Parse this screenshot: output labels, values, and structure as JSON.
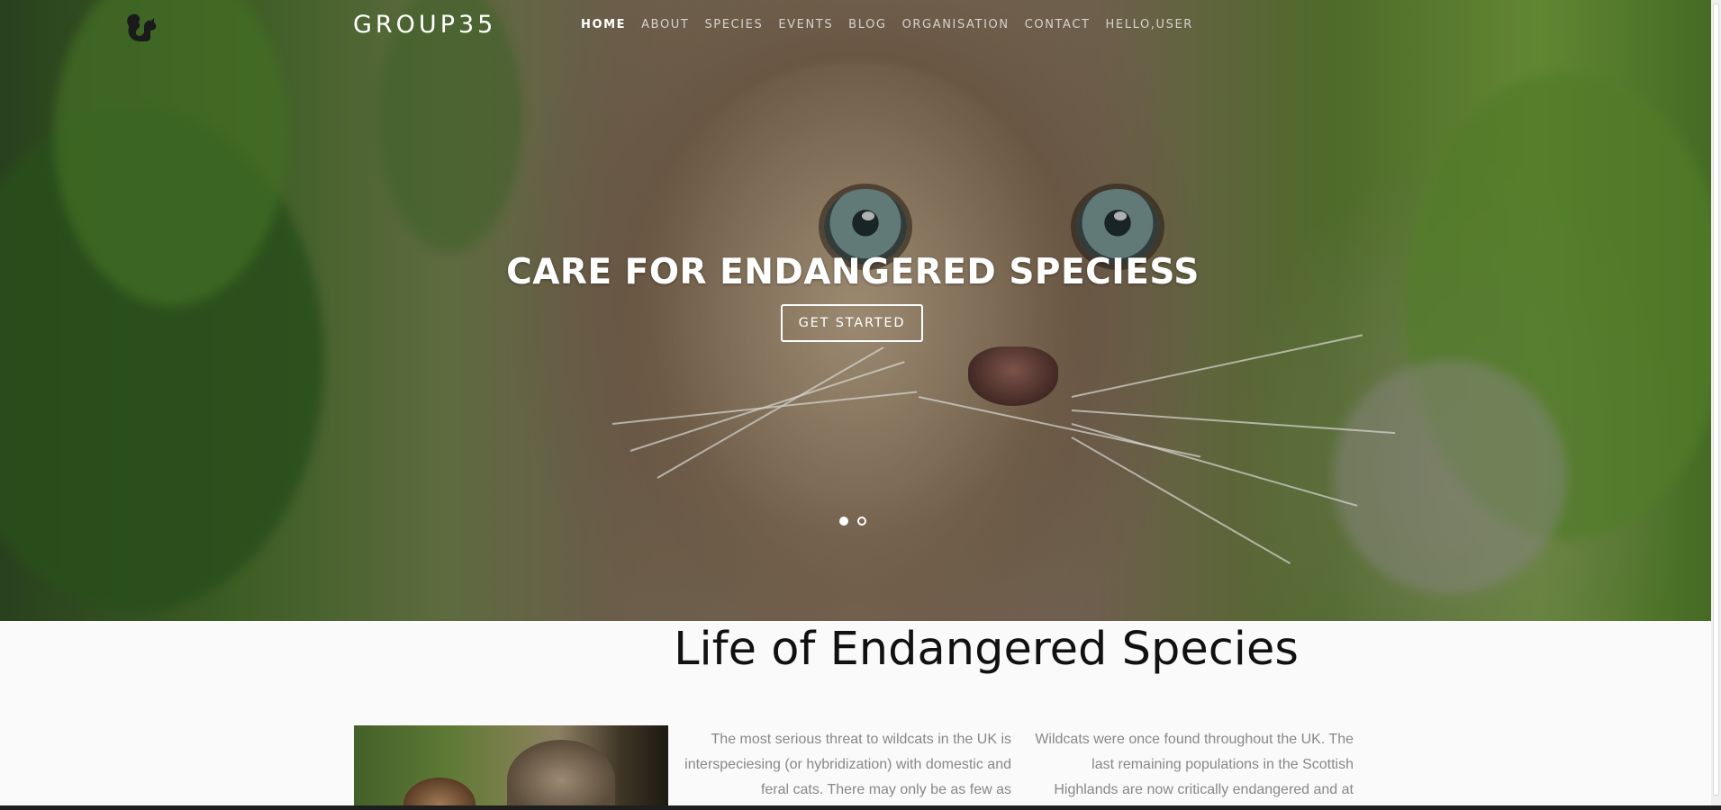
{
  "nav": {
    "brand": "GROUP35",
    "logo_icon": "squirrel-icon",
    "items": [
      {
        "label": "HOME",
        "active": true
      },
      {
        "label": "ABOUT",
        "active": false
      },
      {
        "label": "SPECIES",
        "active": false
      },
      {
        "label": "EVENTS",
        "active": false
      },
      {
        "label": "BLOG",
        "active": false
      },
      {
        "label": "ORGANISATION",
        "active": false
      },
      {
        "label": "CONTACT",
        "active": false
      },
      {
        "label": "HELLO,USER",
        "active": false
      }
    ]
  },
  "hero": {
    "title": "CARE FOR ENDANGERED SPECIESS",
    "cta_label": "GET STARTED",
    "slides": 2,
    "active_slide": 1,
    "image": "wildcat-kitten-photo"
  },
  "main": {
    "section_title": "Life of Endangered Species",
    "thumbnail": "wildcats-photo",
    "paragraph_1": "The most serious threat to wildcats in the UK is interspeciesing (or hybridization) with domestic and feral cats. There may only be as few as",
    "paragraph_2": "Wildcats were once found throughout the UK. The last remaining populations in the Scottish Highlands are now critically endangered and at"
  },
  "colors": {
    "accent": "#ffffff",
    "text_dark": "#111111",
    "text_muted": "#888888",
    "page_bg": "#fafafa"
  }
}
